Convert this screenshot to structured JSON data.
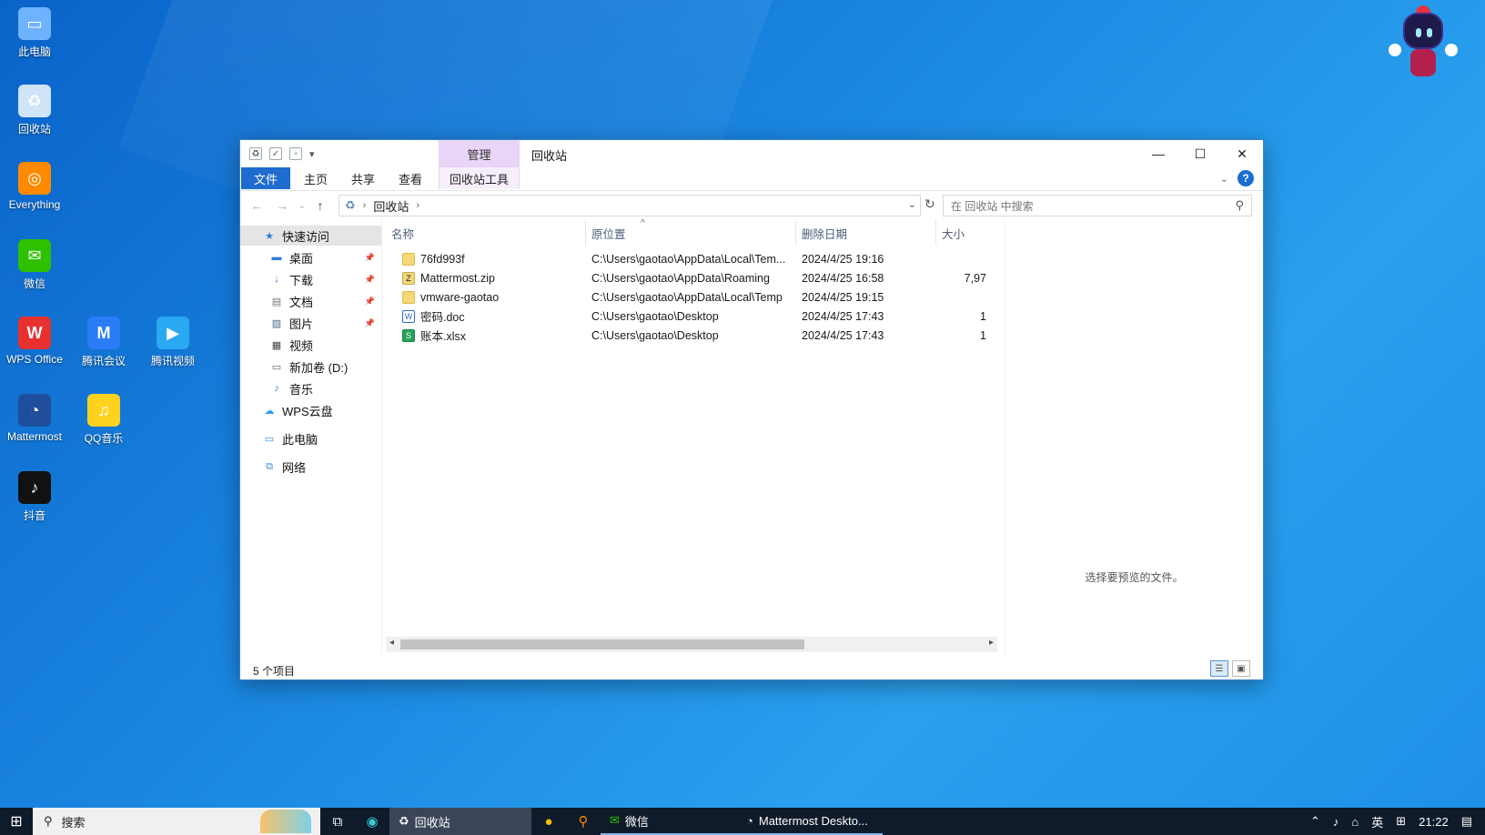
{
  "desktop": {
    "icons": [
      {
        "label": "此电脑",
        "color": "#6fb3ff",
        "glyph": "▭"
      },
      {
        "label": "回收站",
        "color": "#cfe4f7",
        "glyph": "♻"
      },
      {
        "label": "Everything",
        "color": "#ff8a00",
        "glyph": "◎"
      },
      {
        "label": "微信",
        "color": "#2dc100",
        "glyph": "✉"
      },
      {
        "label": "WPS Office",
        "color": "#e8312f",
        "glyph": "W"
      },
      {
        "label": "腾讯会议",
        "color": "#2b7cf6",
        "glyph": "M"
      },
      {
        "label": "腾讯视频",
        "color": "#2aa8f2",
        "glyph": "▶"
      },
      {
        "label": "Mattermost",
        "color": "#1f4f9c",
        "glyph": "◔"
      },
      {
        "label": "QQ音乐",
        "color": "#ffd21f",
        "glyph": "♫"
      },
      {
        "label": "抖音",
        "color": "#111111",
        "glyph": "♪"
      }
    ]
  },
  "window": {
    "manage_tab": "管理",
    "title": "回收站",
    "controls": {
      "minimize": "—",
      "maximize": "☐",
      "close": "✕"
    },
    "ribbon": {
      "tabs": [
        "文件",
        "主页",
        "共享",
        "查看"
      ],
      "tools_tab": "回收站工具",
      "help": "?"
    },
    "nav": {
      "back": "←",
      "forward": "→",
      "recent": "⌄",
      "up": "↑",
      "address_location": "回收站",
      "search_placeholder": "在 回收站 中搜索"
    },
    "navpane": {
      "quick_access": "快速访问",
      "items": [
        {
          "label": "桌面",
          "icon": "desktop-icon",
          "pinned": true,
          "color": "#2b7cd6"
        },
        {
          "label": "下载",
          "icon": "download-icon",
          "pinned": true,
          "color": "#2b7cd6"
        },
        {
          "label": "文档",
          "icon": "document-icon",
          "pinned": true,
          "color": "#777777"
        },
        {
          "label": "图片",
          "icon": "picture-icon",
          "pinned": true,
          "color": "#4a6d8c"
        },
        {
          "label": "视频",
          "icon": "video-icon",
          "pinned": false,
          "color": "#444444"
        },
        {
          "label": "新加卷 (D:)",
          "icon": "drive-icon",
          "pinned": false,
          "color": "#666666"
        },
        {
          "label": "音乐",
          "icon": "music-icon",
          "pinned": false,
          "color": "#2b7cd6"
        }
      ],
      "wps_cloud": "WPS云盘",
      "this_pc": "此电脑",
      "network": "网络"
    },
    "columns": [
      "名称",
      "原位置",
      "删除日期",
      "大小"
    ],
    "files": [
      {
        "name": "76fd993f",
        "type": "folder",
        "location": "C:\\Users\\gaotao\\AppData\\Local\\Tem...",
        "deleted": "2024/4/25 19:16",
        "size": ""
      },
      {
        "name": "Mattermost.zip",
        "type": "zip",
        "location": "C:\\Users\\gaotao\\AppData\\Roaming",
        "deleted": "2024/4/25 16:58",
        "size": "7,97"
      },
      {
        "name": "vmware-gaotao",
        "type": "folder",
        "location": "C:\\Users\\gaotao\\AppData\\Local\\Temp",
        "deleted": "2024/4/25 19:15",
        "size": ""
      },
      {
        "name": "密码.doc",
        "type": "doc",
        "location": "C:\\Users\\gaotao\\Desktop",
        "deleted": "2024/4/25 17:43",
        "size": "1"
      },
      {
        "name": "账本.xlsx",
        "type": "xls",
        "location": "C:\\Users\\gaotao\\Desktop",
        "deleted": "2024/4/25 17:43",
        "size": "1"
      }
    ],
    "preview_message": "选择要预览的文件。",
    "status": "5 个项目"
  },
  "taskbar": {
    "search_label": "搜索",
    "apps": [
      {
        "label": "回收站",
        "state": "active"
      },
      {
        "label": "微信",
        "state": "open"
      },
      {
        "label": "Mattermost Deskto...",
        "state": "open"
      }
    ],
    "tray": {
      "ime": "英",
      "time": "21:22"
    }
  }
}
